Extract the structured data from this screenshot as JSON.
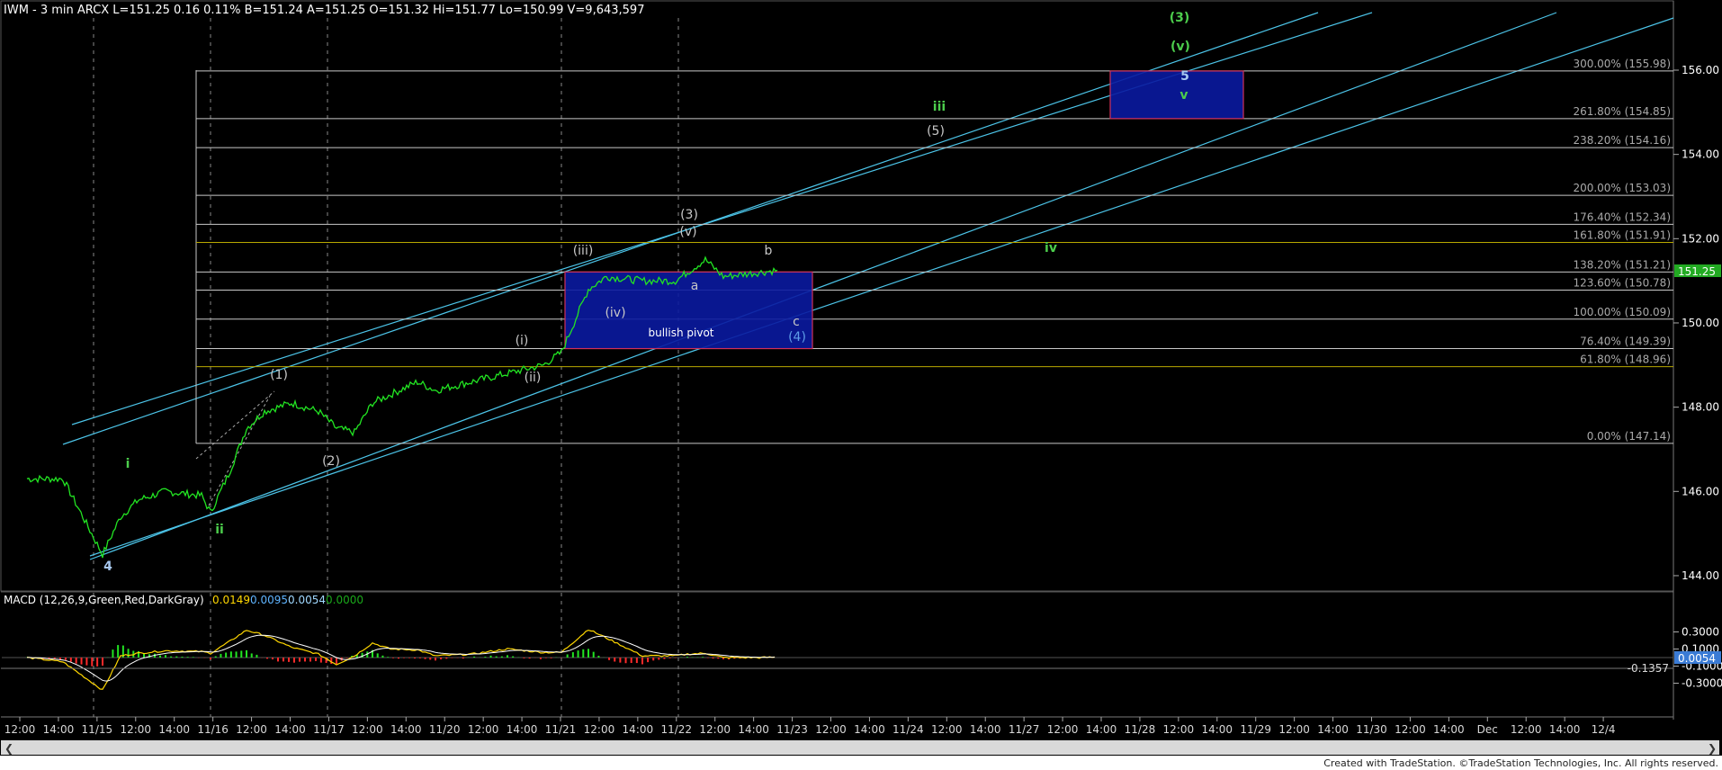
{
  "header": {
    "text": "IWM - 3 min  ARCX  L=151.25  0.16  0.11%   B=151.24  A=151.25  O=151.32  Hi=151.77  Lo=150.99  V=9,643,597"
  },
  "macd": {
    "label": "MACD (12,26,9,Green,Red,DarkGray)",
    "v1": "0.0149",
    "v2": "0.0095",
    "v3": "0.0054",
    "v4": "0.0000"
  },
  "price_axis": {
    "ticks": [
      "156.00",
      "154.00",
      "152.00",
      "150.00",
      "148.00",
      "146.00",
      "144.00"
    ],
    "last": "151.25"
  },
  "macd_axis": {
    "ticks": [
      "0.3000",
      "0.1000",
      "-0.1000",
      "-0.3000"
    ],
    "last": "0.0054",
    "min": "-0.1357"
  },
  "time_axis": {
    "labels": [
      "12:00",
      "14:00",
      "11/15",
      "12:00",
      "14:00",
      "11/16",
      "12:00",
      "14:00",
      "11/17",
      "12:00",
      "14:00",
      "11/20",
      "12:00",
      "14:00",
      "11/21",
      "12:00",
      "14:00",
      "11/22",
      "12:00",
      "14:00",
      "11/23",
      "12:00",
      "14:00",
      "11/24",
      "12:00",
      "14:00",
      "11/27",
      "12:00",
      "14:00",
      "11/28",
      "12:00",
      "14:00",
      "11/29",
      "12:00",
      "14:00",
      "11/30",
      "12:00",
      "14:00",
      "Dec",
      "12:00",
      "14:00",
      "12/4"
    ]
  },
  "fib_levels": [
    {
      "label": "300.00% (155.98)",
      "price": 155.98
    },
    {
      "label": "261.80% (154.85)",
      "price": 154.85
    },
    {
      "label": "238.20% (154.16)",
      "price": 154.16
    },
    {
      "label": "200.00% (153.03)",
      "price": 153.03
    },
    {
      "label": "176.40% (152.34)",
      "price": 152.34
    },
    {
      "label": "161.80% (151.91)",
      "price": 151.91,
      "highlight": true
    },
    {
      "label": "138.20% (151.21)",
      "price": 151.21
    },
    {
      "label": "123.60% (150.78)",
      "price": 150.78
    },
    {
      "label": "100.00% (150.09)",
      "price": 150.09
    },
    {
      "label": "76.40% (149.39)",
      "price": 149.39
    },
    {
      "label": "61.80% (148.96)",
      "price": 148.96,
      "highlight": true
    },
    {
      "label": "0.00% (147.14)",
      "price": 147.14
    }
  ],
  "boxes": [
    {
      "name": "bullish-pivot",
      "label": "bullish pivot",
      "top": 151.21,
      "bottom": 149.39
    },
    {
      "name": "target-box",
      "label": "",
      "top": 155.98,
      "bottom": 154.85
    }
  ],
  "wave_labels": [
    {
      "text": "4",
      "color": "#a8c8f0",
      "size": 20,
      "bold": true
    },
    {
      "text": "i",
      "color": "#4ccd4c",
      "size": 16,
      "bold": true
    },
    {
      "text": "ii",
      "color": "#4ccd4c",
      "size": 16,
      "bold": true
    },
    {
      "text": "(1)",
      "color": "#c8c8c8",
      "size": 14
    },
    {
      "text": "(2)",
      "color": "#c8c8c8",
      "size": 14
    },
    {
      "text": "(i)",
      "color": "#c8c8c8",
      "size": 11
    },
    {
      "text": "(ii)",
      "color": "#c8c8c8",
      "size": 11
    },
    {
      "text": "(iii)",
      "color": "#c8c8c8",
      "size": 11
    },
    {
      "text": "(iv)",
      "color": "#c8c8c8",
      "size": 11
    },
    {
      "text": "(v)",
      "color": "#c8c8c8",
      "size": 11
    },
    {
      "text": "(3)",
      "color": "#c8c8c8",
      "size": 14
    },
    {
      "text": "a",
      "color": "#c8c8c8",
      "size": 11
    },
    {
      "text": "b",
      "color": "#c8c8c8",
      "size": 11
    },
    {
      "text": "c",
      "color": "#c8c8c8",
      "size": 11
    },
    {
      "text": "(4)",
      "color": "#5f9ee8",
      "size": 14
    },
    {
      "text": "(5)",
      "color": "#c8c8c8",
      "size": 14
    },
    {
      "text": "iii",
      "color": "#4ccd4c",
      "size": 17,
      "bold": true
    },
    {
      "text": "iv",
      "color": "#4ccd4c",
      "size": 17,
      "bold": true
    },
    {
      "text": "(3)",
      "color": "#4ccd4c",
      "size": 22,
      "bold": true
    },
    {
      "text": "(v)",
      "color": "#4ccd4c",
      "size": 22,
      "bold": true
    },
    {
      "text": "5",
      "color": "#a8c8f0",
      "size": 20,
      "bold": true
    },
    {
      "text": "v",
      "color": "#4ccd4c",
      "size": 15,
      "bold": true
    }
  ],
  "chart_data": {
    "type": "line",
    "title": "IWM - 3 min",
    "xlabel": "",
    "ylabel": "",
    "ylim": [
      143.3,
      157.4
    ],
    "x": [
      "11/14 12:00",
      "11/14 14:00",
      "11/15 10:00",
      "11/15 11:00",
      "11/15 12:00",
      "11/15 13:30",
      "11/15 15:30",
      "11/16 09:30",
      "11/16 10:30",
      "11/16 11:30",
      "11/16 12:30",
      "11/16 14:00",
      "11/16 15:30",
      "11/17 10:00",
      "11/17 11:00",
      "11/17 12:00",
      "11/17 13:00",
      "11/17 14:30",
      "11/17 15:30",
      "11/20 11:00",
      "11/20 13:00",
      "11/20 15:00",
      "11/21 09:30",
      "11/21 10:00",
      "11/21 11:00",
      "11/21 12:00",
      "11/21 14:00",
      "11/21 15:50",
      "11/22 10:00",
      "11/22 11:00",
      "11/22 12:00",
      "11/22 14:00",
      "11/22 15:00"
    ],
    "series": [
      {
        "values": [
          146.3,
          146.3,
          144.5,
          145.4,
          145.8,
          146.0,
          145.9,
          145.5,
          146.4,
          147.5,
          147.9,
          148.1,
          147.9,
          147.5,
          147.4,
          148.1,
          148.3,
          148.6,
          148.4,
          148.6,
          148.8,
          149.0,
          149.3,
          149.8,
          150.8,
          151.1,
          151.0,
          151.0,
          151.2,
          151.5,
          151.1,
          151.2,
          151.25
        ]
      }
    ],
    "macd": {
      "series": [
        {
          "values": [
            0.0,
            -0.05,
            -0.38,
            0.02,
            0.05,
            0.08,
            0.07,
            0.05,
            0.18,
            0.32,
            0.26,
            0.12,
            0.04,
            -0.08,
            0.02,
            0.17,
            0.1,
            0.09,
            0.02,
            0.04,
            0.1,
            0.06,
            0.06,
            0.15,
            0.33,
            0.23,
            0.02,
            0.02,
            0.04,
            0.05,
            0.0,
            0.0,
            0.005
          ]
        }
      ]
    },
    "grid": false,
    "legend": "none"
  },
  "colors": {
    "background": "#000000",
    "price": "#22e422",
    "channel": "#4cc4e8",
    "fib_line": "#c8c8c8",
    "fib_highlight": "#b8a800",
    "box_fill": "#0a1aa0",
    "box_border": "#d0305a",
    "macd_line": "#ffd700",
    "signal_line": "#ffffff",
    "hist_pos": "#22e422",
    "hist_neg": "#ff2a2a"
  },
  "footer": "Created with TradeStation. ©TradeStation Technologies, Inc. All rights reserved."
}
